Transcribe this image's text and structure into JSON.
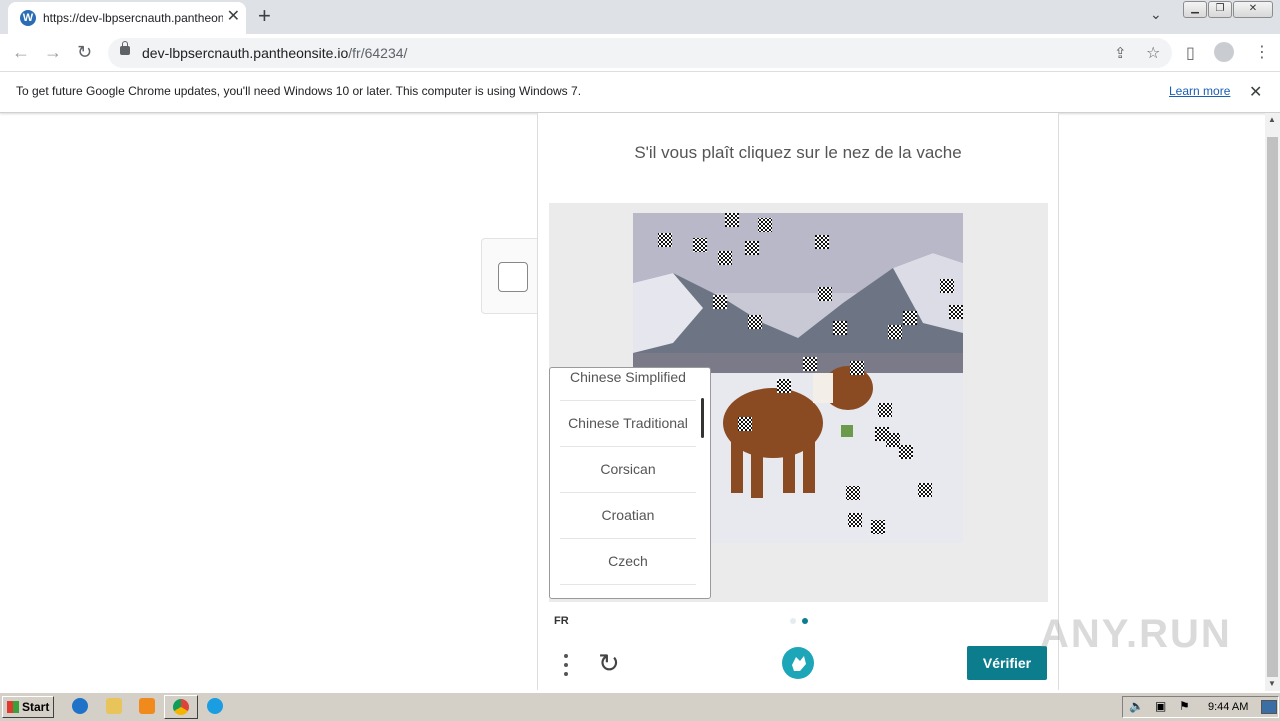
{
  "browser": {
    "tab_title": "https://dev-lbpsercnauth.pantheonsite.io/fr/64234/",
    "url_host": "dev-lbpsercnauth.pantheonsite.io",
    "url_path": "/fr/64234/",
    "infobar_message": "To get future Google Chrome updates, you'll need Windows 10 or later. This computer is using Windows 7.",
    "infobar_link": "Learn more"
  },
  "captcha": {
    "prompt": "S'il vous plaît cliquez sur le nez de la vache",
    "languages": [
      "Chinese Simplified",
      "Chinese Traditional",
      "Corsican",
      "Croatian",
      "Czech"
    ],
    "lang_code": "FR",
    "verify_label": "Vérifier",
    "page_dots": 2,
    "active_dot": 2
  },
  "taskbar": {
    "start_label": "Start",
    "clock": "9:44 AM"
  },
  "watermark": "ANY.RUN",
  "colors": {
    "accent": "#0b7d8d",
    "dot_active": "#0b7d8d",
    "dot_inactive": "#d9e9ec"
  }
}
